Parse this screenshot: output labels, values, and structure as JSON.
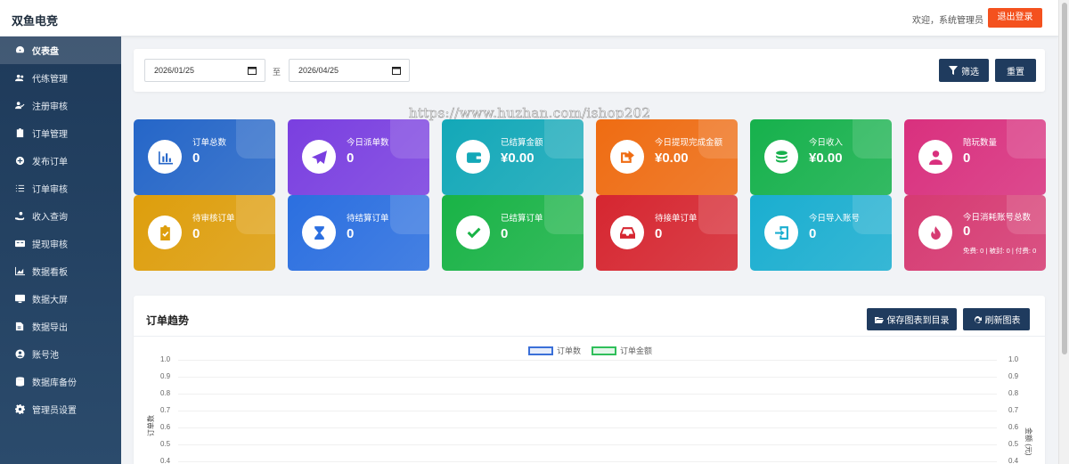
{
  "header": {
    "brand": "双鱼电竞",
    "welcome": "欢迎，系统管理员",
    "logout_label": "退出登录"
  },
  "sidebar": {
    "items": [
      {
        "label": "仪表盘",
        "icon": "dashboard-icon",
        "active": true
      },
      {
        "label": "代练管理",
        "icon": "users-icon"
      },
      {
        "label": "注册审核",
        "icon": "user-check-icon"
      },
      {
        "label": "订单管理",
        "icon": "clipboard-icon"
      },
      {
        "label": "发布订单",
        "icon": "plus-circle-icon"
      },
      {
        "label": "订单审核",
        "icon": "list-check-icon"
      },
      {
        "label": "收入查询",
        "icon": "hand-coin-icon"
      },
      {
        "label": "提现审核",
        "icon": "money-card-icon"
      },
      {
        "label": "数据看板",
        "icon": "chart-area-icon"
      },
      {
        "label": "数据大屏",
        "icon": "monitor-icon"
      },
      {
        "label": "数据导出",
        "icon": "export-icon"
      },
      {
        "label": "账号池",
        "icon": "user-circle-icon"
      },
      {
        "label": "数据库备份",
        "icon": "database-icon"
      },
      {
        "label": "管理员设置",
        "icon": "gear-icon"
      }
    ]
  },
  "filter": {
    "start_date": "2026/01/25",
    "end_date": "2026/04/25",
    "separator": "至",
    "filter_label": "筛选",
    "reset_label": "重置"
  },
  "watermark": "https://www.huzhan.com/ishop202",
  "cards": [
    {
      "label": "订单总数",
      "value": "0",
      "icon": "bar-chart-icon",
      "color": "#2566c8"
    },
    {
      "label": "今日派单数",
      "value": "0",
      "icon": "paper-plane-icon",
      "color": "#7a3fe0"
    },
    {
      "label": "已结算金额",
      "value": "¥0.00",
      "icon": "wallet-icon",
      "color": "#13a8b8"
    },
    {
      "label": "今日提现完成金额",
      "value": "¥0.00",
      "icon": "share-out-icon",
      "color": "#ef6c12"
    },
    {
      "label": "今日收入",
      "value": "¥0.00",
      "icon": "coins-icon",
      "color": "#16b14c"
    },
    {
      "label": "陪玩数量",
      "value": "0",
      "icon": "user-tie-icon",
      "color": "#d9307e"
    },
    {
      "label": "待审核订单",
      "value": "0",
      "icon": "clipboard-check-icon",
      "color": "#de9e0c"
    },
    {
      "label": "待结算订单",
      "value": "0",
      "icon": "hourglass-icon",
      "color": "#2b6fe0"
    },
    {
      "label": "已结算订单",
      "value": "0",
      "icon": "check-icon",
      "color": "#19b346"
    },
    {
      "label": "待接单订单",
      "value": "0",
      "icon": "inbox-icon",
      "color": "#d62630"
    },
    {
      "label": "今日导入账号",
      "value": "0",
      "icon": "import-icon",
      "color": "#1aaed0"
    },
    {
      "label": "今日消耗账号总数",
      "value": "0",
      "icon": "fire-icon",
      "color": "#d63a72",
      "extra": "免费: 0 | 被封: 0 | 付费: 0"
    }
  ],
  "chart_panel": {
    "title": "订单趋势",
    "save_label": "保存图表到目录",
    "refresh_label": "刷新图表"
  },
  "chart_data": {
    "type": "line",
    "title": "",
    "series": [
      {
        "name": "订单数",
        "values": [],
        "color": "#3a6fd8"
      },
      {
        "name": "订单金额",
        "values": [],
        "color": "#2fbf5a"
      }
    ],
    "ylabel": "订单数",
    "y2label": "金额 (元)",
    "ylim": [
      0,
      1.0
    ],
    "y2lim": [
      0,
      1.0
    ],
    "y_ticks": [
      "1.0",
      "0.9",
      "0.8",
      "0.7",
      "0.6",
      "0.5",
      "0.4"
    ],
    "grid": true,
    "legend_position": "top-center"
  }
}
